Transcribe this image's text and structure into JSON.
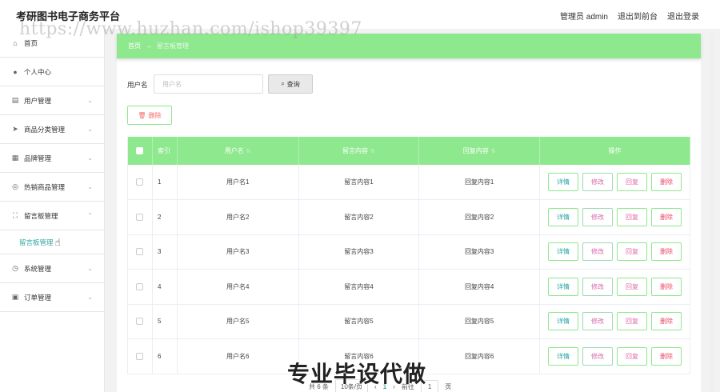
{
  "header": {
    "title": "考研图书电子商务平台",
    "admin_label": "管理员 admin",
    "back_label": "退出到前台",
    "logout_label": "退出登录"
  },
  "watermark": "https://www.huzhan.com/ishop39397",
  "overlay_text": "专业毕设代做",
  "sidebar": {
    "items": [
      {
        "label": "首页",
        "icon": "home-icon"
      },
      {
        "label": "个人中心",
        "icon": "user-icon"
      },
      {
        "label": "用户管理",
        "icon": "document-icon"
      },
      {
        "label": "商品分类管理",
        "icon": "send-icon"
      },
      {
        "label": "品牌管理",
        "icon": "grid-icon"
      },
      {
        "label": "热销商品管理",
        "icon": "compass-icon"
      },
      {
        "label": "留言板管理",
        "icon": "frame-icon"
      },
      {
        "label": "系统管理",
        "icon": "clock-icon"
      },
      {
        "label": "订单管理",
        "icon": "clipboard-icon"
      }
    ],
    "active_sub": "留言板管理"
  },
  "breadcrumb": {
    "home": "首页",
    "sep": "→",
    "current": "留言板管理"
  },
  "search": {
    "label": "用户名",
    "placeholder": "用户名",
    "button": "查询"
  },
  "delete_button": "删除",
  "table": {
    "headers": [
      "索引",
      "用户名",
      "留言内容",
      "回复内容",
      "操作"
    ],
    "rows": [
      {
        "index": "1",
        "user": "用户名1",
        "content": "留言内容1",
        "reply": "回复内容1"
      },
      {
        "index": "2",
        "user": "用户名2",
        "content": "留言内容2",
        "reply": "回复内容2"
      },
      {
        "index": "3",
        "user": "用户名3",
        "content": "留言内容3",
        "reply": "回复内容3"
      },
      {
        "index": "4",
        "user": "用户名4",
        "content": "留言内容4",
        "reply": "回复内容4"
      },
      {
        "index": "5",
        "user": "用户名5",
        "content": "留言内容5",
        "reply": "回复内容5"
      },
      {
        "index": "6",
        "user": "用户名6",
        "content": "留言内容6",
        "reply": "回复内容6"
      }
    ],
    "actions": {
      "detail": "详情",
      "edit": "修改",
      "reply": "回复",
      "remove": "删除"
    }
  },
  "pagination": {
    "total": "共 6 条",
    "page_size": "10条/页",
    "prev": "‹",
    "current": "1",
    "next": "›",
    "goto": "前往",
    "goto_value": "1",
    "page_unit": "页"
  },
  "colors": {
    "accent": "#8ee88e",
    "active": "#34a7a0"
  }
}
